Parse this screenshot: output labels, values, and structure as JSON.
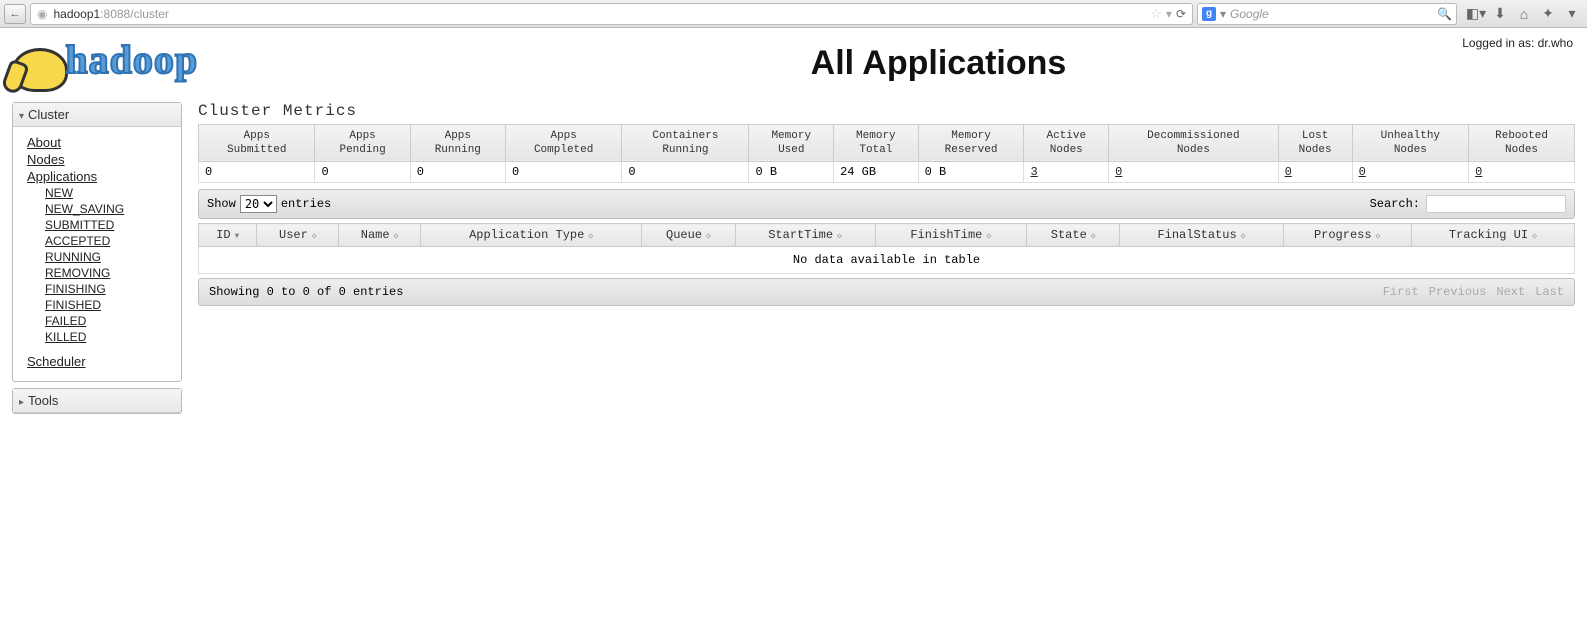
{
  "browser": {
    "url_host": "hadoop1",
    "url_path": ":8088/cluster",
    "search_placeholder": "Google",
    "reload_glyph": "⟳",
    "back_glyph": "←",
    "dropdown_glyph": "▾"
  },
  "header": {
    "logo_text": "hadoop",
    "title": "All Applications",
    "login_status": "Logged in as: dr.who"
  },
  "sidebar": {
    "cluster_label": "Cluster",
    "tools_label": "Tools",
    "links": {
      "about": "About",
      "nodes": "Nodes",
      "applications": "Applications",
      "scheduler": "Scheduler"
    },
    "app_states": [
      "NEW",
      "NEW_SAVING",
      "SUBMITTED",
      "ACCEPTED",
      "RUNNING",
      "REMOVING",
      "FINISHING",
      "FINISHED",
      "FAILED",
      "KILLED"
    ]
  },
  "metrics": {
    "title": "Cluster Metrics",
    "headers": [
      "Apps Submitted",
      "Apps Pending",
      "Apps Running",
      "Apps Completed",
      "Containers Running",
      "Memory Used",
      "Memory Total",
      "Memory Reserved",
      "Active Nodes",
      "Decommissioned Nodes",
      "Lost Nodes",
      "Unhealthy Nodes",
      "Rebooted Nodes"
    ],
    "values": [
      "0",
      "0",
      "0",
      "0",
      "0",
      "0 B",
      "24 GB",
      "0 B",
      "3",
      "0",
      "0",
      "0",
      "0"
    ],
    "link_cols": [
      8,
      9,
      10,
      11,
      12
    ]
  },
  "table": {
    "show_label_pre": "Show",
    "show_label_post": "entries",
    "page_size": "20",
    "search_label": "Search:",
    "columns": [
      "ID",
      "User",
      "Name",
      "Application Type",
      "Queue",
      "StartTime",
      "FinishTime",
      "State",
      "FinalStatus",
      "Progress",
      "Tracking UI"
    ],
    "empty_msg": "No data available in table",
    "info": "Showing 0 to 0 of 0 entries",
    "pager": [
      "First",
      "Previous",
      "Next",
      "Last"
    ]
  }
}
